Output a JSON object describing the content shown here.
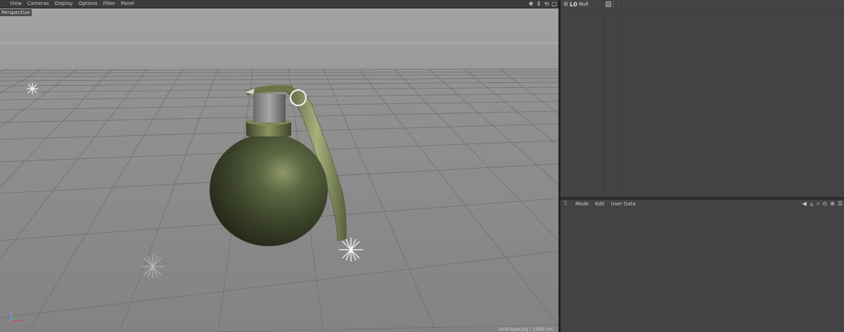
{
  "viewport": {
    "menu": [
      "View",
      "Cameras",
      "Display",
      "Options",
      "Filter",
      "Panel"
    ],
    "camera_label": "Perspective",
    "grid_spacing": "Grid Spacing : 1000 cm",
    "nav_icons": [
      "move-view-icon",
      "dolly-icon",
      "rotate-view-icon",
      "maximize-view-icon"
    ]
  },
  "object_manager": {
    "objects": [
      {
        "name": "Null",
        "icon": "null-object-icon"
      }
    ]
  },
  "attribute_manager": {
    "menu": [
      "Mode",
      "Edit",
      "User Data"
    ],
    "icons": [
      "back-arrow-icon",
      "search-icon",
      "lock-icon",
      "new-panel-icon",
      "menu-icon"
    ]
  },
  "colors": {
    "viewport_sky": "#9d9d9d",
    "viewport_floor": "#8c8c8c",
    "panel_bg": "#434343",
    "grenade_body": "#4a5236",
    "grenade_lever": "#7e8a58"
  }
}
